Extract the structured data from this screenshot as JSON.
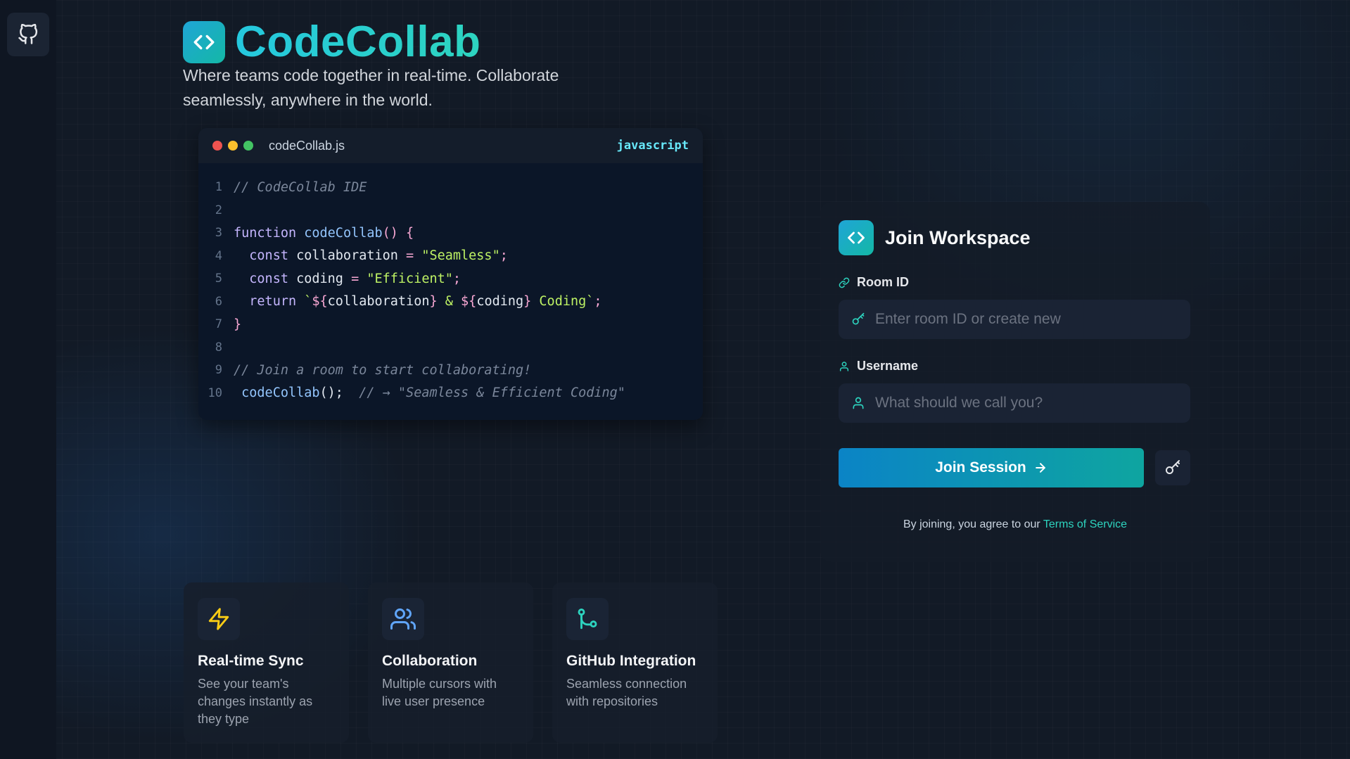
{
  "brand": {
    "title": "CodeCollab",
    "tagline": "Where teams code together in real-time. Collaborate seamlessly, anywhere in the world."
  },
  "editor": {
    "filename": "codeCollab.js",
    "language": "javascript",
    "line_numbers": [
      "1",
      "2",
      "3",
      "4",
      "5",
      "6",
      "7",
      "8",
      "9",
      "10"
    ],
    "lines": [
      [
        {
          "t": "// CodeCollab IDE",
          "c": "com"
        }
      ],
      [],
      [
        {
          "t": "function ",
          "c": "kw"
        },
        {
          "t": "codeCollab",
          "c": "fn"
        },
        {
          "t": "() {",
          "c": "pun"
        }
      ],
      [
        {
          "t": "  const ",
          "c": "kw"
        },
        {
          "t": "collaboration",
          "c": "txt"
        },
        {
          "t": " = ",
          "c": "pun"
        },
        {
          "t": "\"Seamless\"",
          "c": "str"
        },
        {
          "t": ";",
          "c": "pun"
        }
      ],
      [
        {
          "t": "  const ",
          "c": "kw"
        },
        {
          "t": "coding",
          "c": "txt"
        },
        {
          "t": " = ",
          "c": "pun"
        },
        {
          "t": "\"Efficient\"",
          "c": "str"
        },
        {
          "t": ";",
          "c": "pun"
        }
      ],
      [
        {
          "t": "  return ",
          "c": "kw"
        },
        {
          "t": "`",
          "c": "str"
        },
        {
          "t": "${",
          "c": "pun"
        },
        {
          "t": "collaboration",
          "c": "txt"
        },
        {
          "t": "}",
          "c": "pun"
        },
        {
          "t": " & ",
          "c": "str"
        },
        {
          "t": "${",
          "c": "pun"
        },
        {
          "t": "coding",
          "c": "txt"
        },
        {
          "t": "}",
          "c": "pun"
        },
        {
          "t": " Coding`",
          "c": "str"
        },
        {
          "t": ";",
          "c": "pun"
        }
      ],
      [
        {
          "t": "}",
          "c": "pun"
        }
      ],
      [],
      [
        {
          "t": "// Join a room to start collaborating!",
          "c": "com"
        }
      ],
      [
        {
          "t": " codeCollab",
          "c": "fn"
        },
        {
          "t": "();",
          "c": "txt"
        },
        {
          "t": "  // → \"Seamless & Efficient Coding\"",
          "c": "com"
        }
      ]
    ]
  },
  "features": [
    {
      "title": "Real-time Sync",
      "desc": "See your team's changes instantly as they type",
      "icon": "lightning-icon"
    },
    {
      "title": "Collaboration",
      "desc": "Multiple cursors with live user presence",
      "icon": "users-icon"
    },
    {
      "title": "GitHub Integration",
      "desc": "Seamless connection with repositories",
      "icon": "git-branch-icon"
    }
  ],
  "join": {
    "title": "Join Workspace",
    "room_label": "Room ID",
    "room_placeholder": "Enter room ID or create new",
    "room_value": "",
    "username_label": "Username",
    "username_placeholder": "What should we call you?",
    "username_value": "",
    "button_label": "Join Session",
    "terms_text": "By joining, you agree to our ",
    "terms_link": "Terms of Service"
  },
  "colors": {
    "accent": "#14b8a6",
    "brand_blue": "#1fa5d6",
    "background": "#121a26"
  }
}
